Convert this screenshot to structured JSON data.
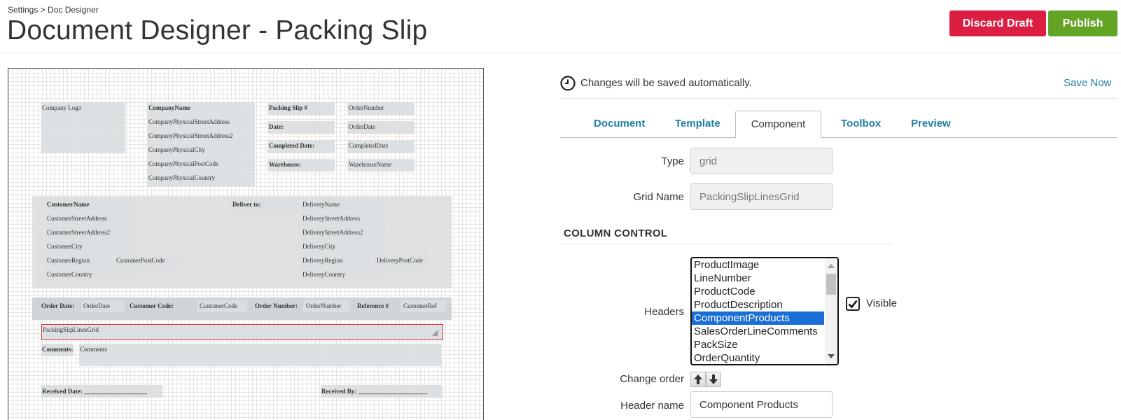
{
  "header": {
    "breadcrumb": "Settings > Doc Designer",
    "title": "Document Designer - Packing Slip",
    "discard_label": "Discard Draft",
    "publish_label": "Publish"
  },
  "canvas": {
    "company_logo": "Company Logo",
    "company_name": "CompanyName",
    "company_address": [
      "CompanyPhysicalStreetAddress",
      "CompanyPhysicalStreetAddress2",
      "CompanyPhysicalCity",
      "CompanyPhysicalPostCode",
      "CompanyPhysicalCountry"
    ],
    "slip_labels": [
      "Packing Slip #",
      "Date:",
      "Completed Date:",
      "Warehouse:"
    ],
    "slip_values": [
      "OrderNumber",
      "OrderDate",
      "CompletedDate",
      "WarehouseName"
    ],
    "customer": [
      "CustomerName",
      "CustomerStreetAddress",
      "CustomerStreetAddress2",
      "CustomerCity",
      "CustomerRegion",
      "CustomerCountry"
    ],
    "customer_postcode": "CustomerPostCode",
    "deliver_to_label": "Deliver to:",
    "delivery": [
      "DeliveryName",
      "DeliveryStreetAddress",
      "DeliveryStreetAddress2",
      "DeliveryCity",
      "DeliveryRegion",
      "DeliveryCountry"
    ],
    "delivery_postcode": "DeliveryPostCode",
    "order_row": {
      "order_date_label": "Order Date:",
      "order_date": "OrderDate",
      "customer_code_label": "Customer Code:",
      "customer_code": "CustomerCode",
      "order_number_label": "Order Number:",
      "order_number": "OrderNumber",
      "reference_label": "Reference #",
      "customer_ref": "CustomerRef"
    },
    "grid_name": "PackingSlipLinesGrid",
    "comments_label": "Comments:",
    "comments": "Comments",
    "received_date": "Received Date: ____________________",
    "received_by": "Received By: ______________________"
  },
  "panel": {
    "autosave_text": "Changes will be saved automatically.",
    "save_now": "Save Now",
    "tabs": [
      "Document",
      "Template",
      "Component",
      "Toolbox",
      "Preview"
    ],
    "active_tab": "Component",
    "type_label": "Type",
    "type_value": "grid",
    "grid_name_label": "Grid Name",
    "grid_name_value": "PackingSlipLinesGrid",
    "section_title": "COLUMN CONTROL",
    "headers_label": "Headers",
    "headers": [
      "ProductImage",
      "LineNumber",
      "ProductCode",
      "ProductDescription",
      "ComponentProducts",
      "SalesOrderLineComments",
      "PackSize",
      "OrderQuantity"
    ],
    "selected_header": "ComponentProducts",
    "visible_label": "Visible",
    "visible_checked": true,
    "change_order_label": "Change order",
    "header_name_label": "Header name",
    "header_name_value": "Component Products"
  },
  "colors": {
    "discard": "#dc1e43",
    "publish": "#64a425",
    "link": "#1f7fa5",
    "selection": "#1a6fd6"
  }
}
